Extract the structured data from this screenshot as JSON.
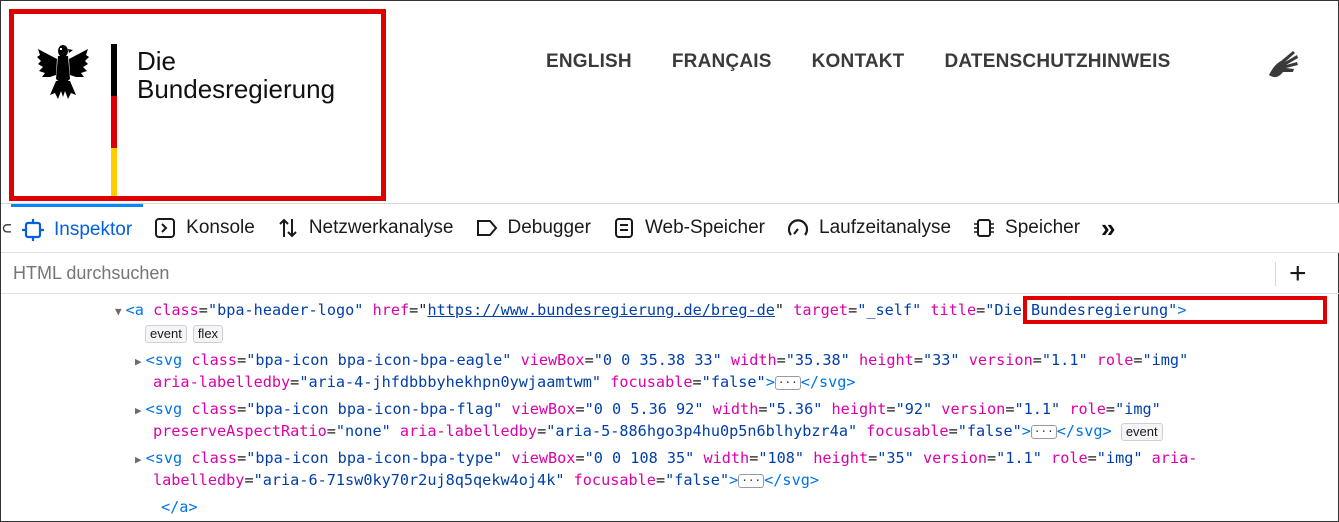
{
  "site": {
    "brand_line1": "Die",
    "brand_line2": "Bundesregierung",
    "nav": [
      "ENGLISH",
      "FRANÇAIS",
      "KONTAKT",
      "DATENSCHUTZHINWEIS"
    ],
    "colors": {
      "flag_black": "#000000",
      "flag_red": "#dd0000",
      "flag_gold": "#ffcc00",
      "highlight": "#e00000"
    }
  },
  "devtools": {
    "tabs": [
      {
        "label": "Inspektor",
        "icon": "inspector-icon",
        "active": true
      },
      {
        "label": "Konsole",
        "icon": "console-icon"
      },
      {
        "label": "Netzwerkanalyse",
        "icon": "network-icon"
      },
      {
        "label": "Debugger",
        "icon": "debugger-icon"
      },
      {
        "label": "Web-Speicher",
        "icon": "storage-icon"
      },
      {
        "label": "Laufzeitanalyse",
        "icon": "performance-icon"
      },
      {
        "label": "Speicher",
        "icon": "memory-icon"
      }
    ],
    "more": "»",
    "search_placeholder": "HTML durchsuchen",
    "add": "+",
    "markup": {
      "a_tag": "<a",
      "a_class_attr": "class",
      "a_class_val": "\"bpa-header-logo\"",
      "a_href_attr": "href",
      "a_href_val": "https://www.bundesregierung.de/breg-de",
      "a_target_attr": "target",
      "a_target_val": "\"_self\"",
      "a_title_attr": "title",
      "a_title_val": "\"Die Bundesregierung\"",
      "a_close": ">",
      "badge_event": "event",
      "badge_flex": "flex",
      "svg1": {
        "tag": "<svg",
        "class_val": "\"bpa-icon bpa-icon-bpa-eagle\"",
        "viewbox_val": "\"0 0 35.38 33\"",
        "width_val": "\"35.38\"",
        "height_val": "\"33\"",
        "version_val": "\"1.1\"",
        "role_val": "\"img\"",
        "aria_val": "\"aria-4-jhfdbbbyhekhpn0ywjaamtwm\"",
        "focusable_val": "\"false\""
      },
      "svg2": {
        "class_val": "\"bpa-icon bpa-icon-bpa-flag\"",
        "viewbox_val": "\"0 0 5.36 92\"",
        "width_val": "\"5.36\"",
        "height_val": "\"92\"",
        "version_val": "\"1.1\"",
        "role_val": "\"img\"",
        "preserve_val": "\"none\"",
        "aria_val": "\"aria-5-886hgo3p4hu0p5n6blhybzr4a\"",
        "focusable_val": "\"false\""
      },
      "svg3": {
        "class_val": "\"bpa-icon bpa-icon-bpa-type\"",
        "viewbox_val": "\"0 0 108 35\"",
        "width_val": "\"108\"",
        "height_val": "\"35\"",
        "version_val": "\"1.1\"",
        "role_val": "\"img\"",
        "aria_part1": "aria-",
        "aria_part2": "labelledby",
        "aria_val": "\"aria-6-71sw0ky70r2uj8q5qekw4oj4k\"",
        "focusable_val": "\"false\""
      },
      "ellipsis": "···",
      "svg_close": "</svg>",
      "a_end": "</a>"
    }
  }
}
